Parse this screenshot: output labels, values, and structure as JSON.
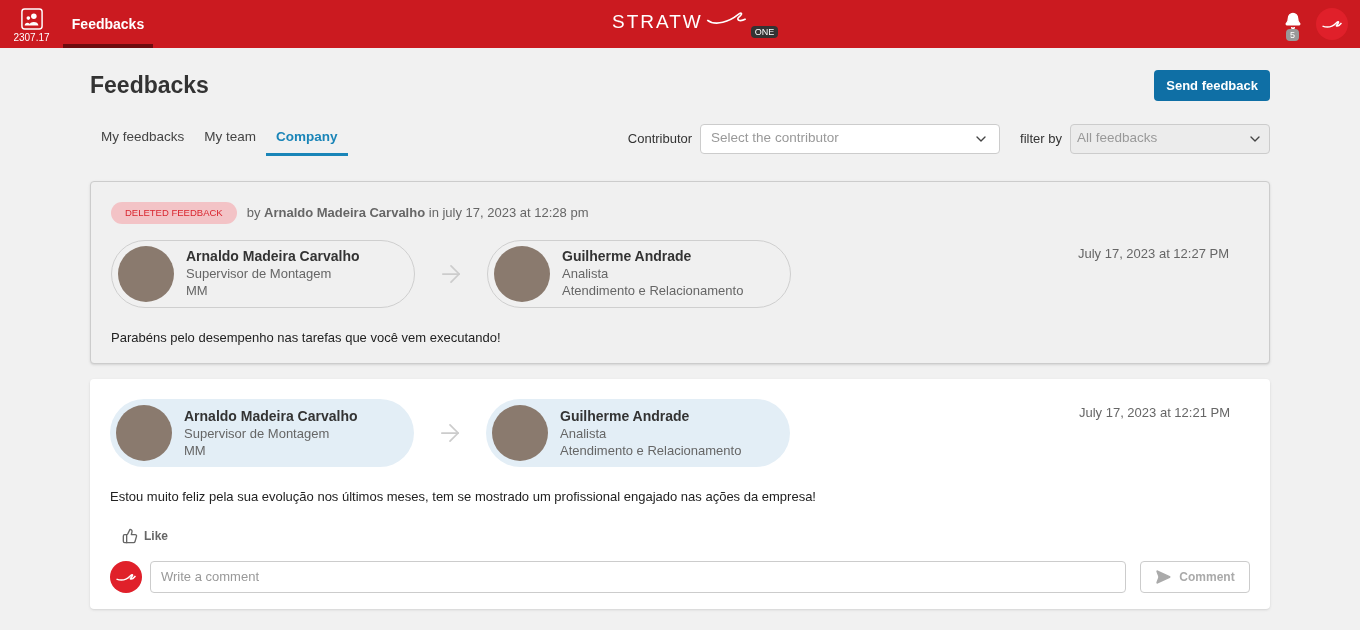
{
  "header": {
    "app_badge": "2307.17",
    "nav": [
      {
        "label": "Feedbacks",
        "selected": true
      }
    ],
    "logo": {
      "text": "STRATW",
      "badge": "ONE"
    },
    "notifications": "5"
  },
  "page": {
    "title": "Feedbacks",
    "send_button": "Send feedback"
  },
  "tabs": [
    {
      "label": "My feedbacks",
      "selected": false
    },
    {
      "label": "My team",
      "selected": false
    },
    {
      "label": "Company",
      "selected": true
    }
  ],
  "filters": {
    "contributor_label": "Contributor",
    "contributor_placeholder": "Select the contributor",
    "filter_label": "filter by",
    "filter_value": "All feedbacks"
  },
  "feedbacks": [
    {
      "deleted": true,
      "deleted_badge": "DELETED FEEDBACK",
      "deleted_by": "by **Arnaldo Madeira Carvalho** in july 17, 2023 at 12:28 pm",
      "from": {
        "name": "Arnaldo Madeira Carvalho",
        "role": "Supervisor de Montagem",
        "dept": "MM"
      },
      "to": {
        "name": "Guilherme Andrade",
        "role": "Analista",
        "dept": "Atendimento e Relacionamento"
      },
      "date": "July 17, 2023 at 12:27 PM",
      "message": "Parabéns pelo desempenho nas tarefas que você vem executando!"
    },
    {
      "deleted": false,
      "from": {
        "name": "Arnaldo Madeira Carvalho",
        "role": "Supervisor de Montagem",
        "dept": "MM"
      },
      "to": {
        "name": "Guilherme Andrade",
        "role": "Analista",
        "dept": "Atendimento e Relacionamento"
      },
      "date": "July 17, 2023 at 12:21 PM",
      "message": "Estou muito feliz pela sua evolução nos últimos meses, tem se mostrado um profissional engajado nas ações da empresa!",
      "like": "Like",
      "comment_placeholder": "Write a comment",
      "comment_button": "Comment"
    }
  ]
}
